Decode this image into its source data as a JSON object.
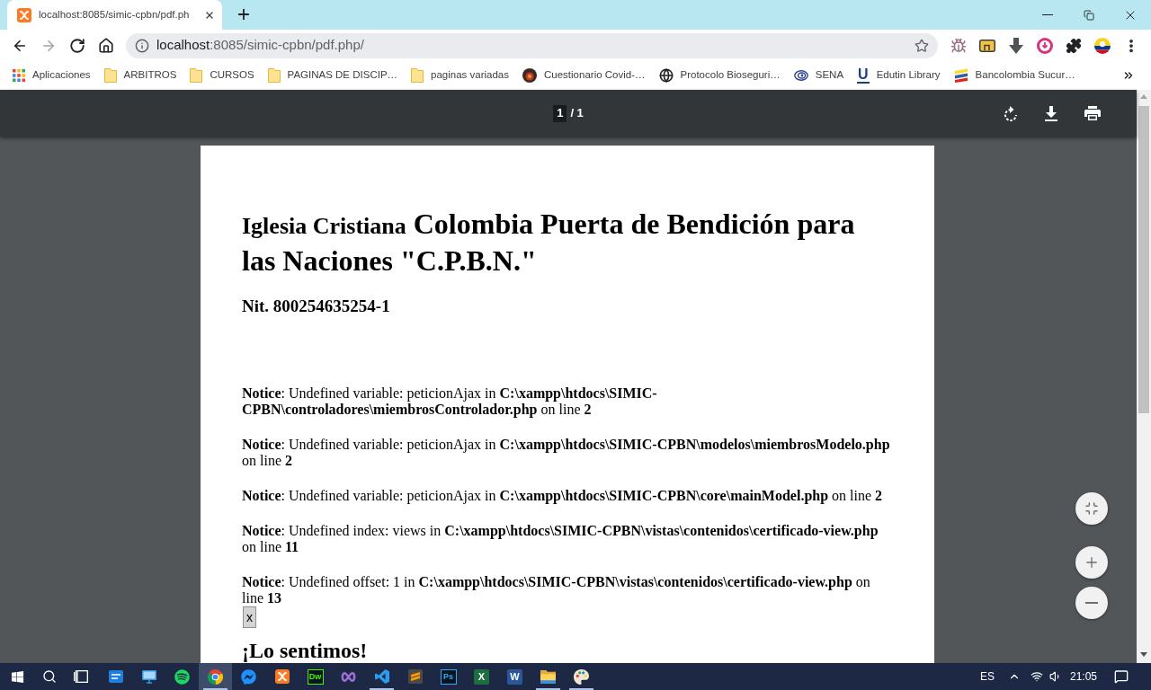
{
  "browser": {
    "tab": {
      "title": "localhost:8085/simic-cpbn/pdf.ph",
      "selected": true
    },
    "navigation": {
      "back": {
        "disabled": false
      },
      "forward": {
        "disabled": true
      }
    },
    "address": {
      "host": "localhost",
      "path": ":8085/simic-cpbn/pdf.php/"
    },
    "bookmarks": [
      {
        "kind": "apps",
        "label": "Aplicaciones"
      },
      {
        "kind": "folder",
        "label": "ARBITROS"
      },
      {
        "kind": "folder",
        "label": "CURSOS"
      },
      {
        "kind": "folder",
        "label": "PAGINAS DE DISCIP…"
      },
      {
        "kind": "folder",
        "label": "paginas variadas"
      },
      {
        "kind": "badge",
        "label": "Cuestionario Covid-…"
      },
      {
        "kind": "globe",
        "label": "Protocolo Bioseguri…"
      },
      {
        "kind": "eye",
        "label": "SENA"
      },
      {
        "kind": "letter",
        "glyph": "U",
        "label": "Edutin Library"
      },
      {
        "kind": "stripes",
        "label": "Bancolombia Sucur…"
      }
    ]
  },
  "pdf_viewer": {
    "page_number": "1",
    "page_count": "/ 1",
    "document": {
      "title_prefix": "Iglesia Cristiana",
      "title_main": "Colombia Puerta de Bendición para las Naciones \"C.P.B.N.\"",
      "nit": "Nit. 800254635254-1",
      "notices": [
        "**Notice**: Undefined variable: peticionAjax in **C:\\xampp\\htdocs\\SIMIC-CPBN\\controladores\\miembrosControlador.php** on line **2**",
        "**Notice**: Undefined variable: peticionAjax in **C:\\xampp\\htdocs\\SIMIC-CPBN\\modelos\\miembrosModelo.php** on line **2**",
        "**Notice**: Undefined variable: peticionAjax in **C:\\xampp\\htdocs\\SIMIC-CPBN\\core\\mainModel.php** on line **2**",
        "**Notice**: Undefined index: views in **C:\\xampp\\htdocs\\SIMIC-CPBN\\vistas\\contenidos\\certificado-view.php** on line **11**",
        "**Notice**: Undefined offset: 1 in **C:\\xampp\\htdocs\\SIMIC-CPBN\\vistas\\contenidos\\certificado-view.php** on line **13**"
      ],
      "button_label": "x",
      "subheading": "¡Lo sentimos!"
    }
  },
  "taskbar": {
    "apps": [
      {
        "kind": "card",
        "running": false,
        "selected": false
      },
      {
        "kind": "monitor",
        "running": false,
        "selected": false
      },
      {
        "kind": "music",
        "running": false,
        "selected": false
      },
      {
        "kind": "browser",
        "running": true,
        "selected": true
      },
      {
        "kind": "chat",
        "running": false,
        "selected": false
      },
      {
        "kind": "server",
        "running": false,
        "selected": false
      },
      {
        "kind": "outlined",
        "glyph": "Dw",
        "color": "#46f000",
        "running": false,
        "selected": false
      },
      {
        "kind": "infinity",
        "running": false,
        "selected": false
      },
      {
        "kind": "code",
        "running": true,
        "selected": false
      },
      {
        "kind": "editor",
        "running": false,
        "selected": false
      },
      {
        "kind": "outlined",
        "glyph": "Ps",
        "color": "#31a8ff",
        "running": false,
        "selected": false
      },
      {
        "kind": "filled",
        "glyph": "X",
        "color": "#1d6f42",
        "running": false,
        "selected": false
      },
      {
        "kind": "filled",
        "glyph": "W",
        "color": "#2b579a",
        "running": false,
        "selected": false
      },
      {
        "kind": "folder",
        "running": true,
        "selected": false
      },
      {
        "kind": "palette",
        "running": true,
        "selected": false
      }
    ],
    "language": "ES",
    "clock": "21:05"
  }
}
